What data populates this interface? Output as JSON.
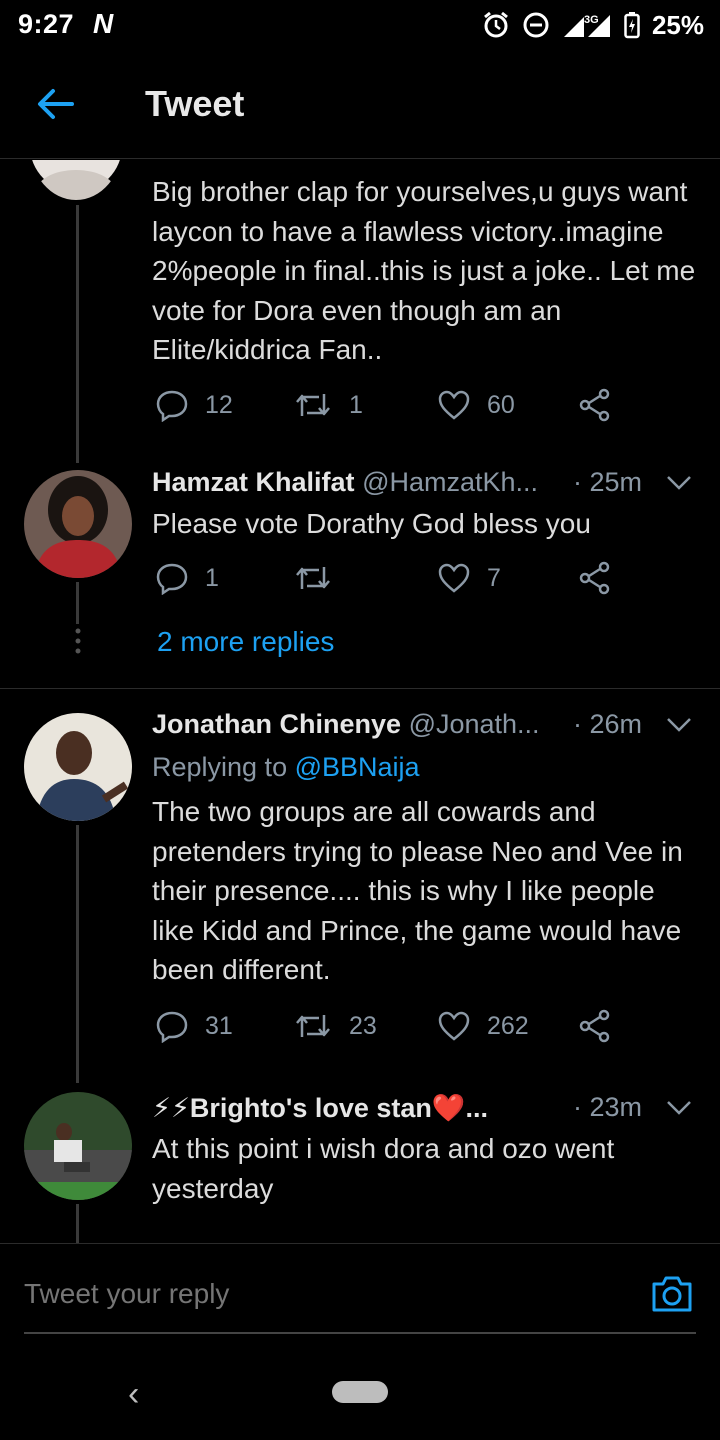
{
  "status": {
    "time": "9:27",
    "carrier_glyph": "N",
    "network": "3G",
    "battery": "25%"
  },
  "header": {
    "title": "Tweet"
  },
  "tweets": [
    {
      "text": "Big brother clap for yourselves,u guys want laycon to have a flawless victory..imagine 2%people in final..this is just a joke.. Let me vote for Dora even though am an Elite/kiddrica Fan..",
      "replies": "12",
      "retweets": "1",
      "likes": "60"
    },
    {
      "name": "Hamzat Khalifat",
      "handle": "@HamzatKh...",
      "time": "· 25m",
      "text": "Please vote Dorathy God bless you",
      "replies": "1",
      "retweets": "",
      "likes": "7"
    },
    {
      "name": "Jonathan Chinenye",
      "handle": "@Jonath...",
      "time": "· 26m",
      "replying_prefix": "Replying to ",
      "replying_to": "@BBNaija",
      "text": "The two groups are all cowards and pretenders trying to please Neo and Vee in their presence.... this is why I like people like Kidd and Prince, the game would have been different.",
      "replies": "31",
      "retweets": "23",
      "likes": "262"
    },
    {
      "name": "⚡⚡Brighto's love stan❤️...",
      "time": "· 23m",
      "text": "At this point i wish dora and ozo went yesterday"
    }
  ],
  "more_replies": "2 more replies",
  "reply_bar": {
    "placeholder": "Tweet your reply"
  },
  "icons": {
    "back": "back-arrow-icon",
    "reply": "reply-icon",
    "retweet": "retweet-icon",
    "like": "heart-icon",
    "share": "share-icon",
    "camera": "camera-icon"
  },
  "colors": {
    "accent": "#1da1f2",
    "background": "#000000",
    "muted": "#8b98a5"
  }
}
